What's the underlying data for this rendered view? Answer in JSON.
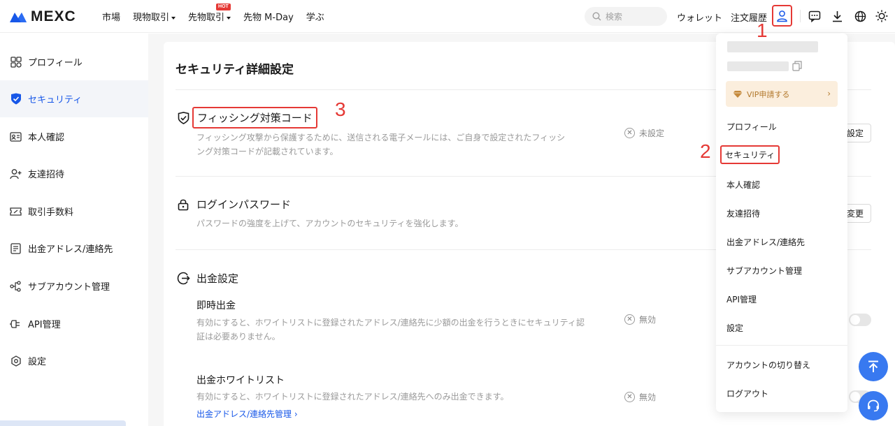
{
  "brand": {
    "name": "MEXC",
    "accent": "#1757e8",
    "annotation_color": "#e53935"
  },
  "nav": {
    "items": [
      {
        "label": "市場",
        "caret": false
      },
      {
        "label": "現物取引",
        "caret": true
      },
      {
        "label": "先物取引",
        "caret": true,
        "badge": "HOT"
      },
      {
        "label": "先物 M-Day",
        "caret": false
      },
      {
        "label": "学ぶ",
        "caret": false
      }
    ]
  },
  "header": {
    "search_placeholder": "検索",
    "wallet": "ウォレット",
    "orders": "注文履歴",
    "icons": [
      "user-icon",
      "chat-icon",
      "download-icon",
      "globe-icon",
      "theme-icon"
    ]
  },
  "sidebar": {
    "items": [
      {
        "label": "プロフィール",
        "icon": "profile-grid-icon",
        "active": false
      },
      {
        "label": "セキュリティ",
        "icon": "shield-check-icon",
        "active": true
      },
      {
        "label": "本人確認",
        "icon": "id-card-icon",
        "active": false
      },
      {
        "label": "友達招待",
        "icon": "add-user-icon",
        "active": false
      },
      {
        "label": "取引手数料",
        "icon": "fee-ticket-icon",
        "active": false
      },
      {
        "label": "出金アドレス/連絡先",
        "icon": "address-book-icon",
        "active": false
      },
      {
        "label": "サブアカウント管理",
        "icon": "sub-account-icon",
        "active": false
      },
      {
        "label": "API管理",
        "icon": "api-plug-icon",
        "active": false
      },
      {
        "label": "設定",
        "icon": "settings-hex-icon",
        "active": false
      }
    ]
  },
  "main": {
    "title": "セキュリティ詳細設定",
    "sections": {
      "phishing": {
        "title": "フィッシング対策コード",
        "desc_line1": "フィッシング攻撃から保護するために、送信される電子メールには、ご自身で設定されたフィッシ",
        "desc_line2": "ング対策コードが記載されています。",
        "status": "未設定",
        "action": "設定"
      },
      "login_password": {
        "title": "ログインパスワード",
        "desc": "パスワードの強度を上げて、アカウントのセキュリティを強化します。",
        "action": "変更"
      },
      "withdrawal": {
        "title": "出金設定",
        "instant": {
          "title": "即時出金",
          "desc_line1": "有効にすると、ホワイトリストに登録されたアドレス/連絡先に少額の出金を行うときにセキュリティ認",
          "desc_line2": "証は必要ありません。",
          "status": "無効"
        },
        "whitelist": {
          "title": "出金ホワイトリスト",
          "desc": "有効にすると、ホワイトリストに登録されたアドレス/連絡先へのみ出金できます。",
          "status": "無効",
          "link": "出金アドレス/連絡先管理 ›"
        }
      }
    }
  },
  "dropdown": {
    "vip": "VIP申請する",
    "items": [
      "プロフィール",
      "セキュリティ",
      "本人確認",
      "友達招待",
      "出金アドレス/連絡先",
      "サブアカウント管理",
      "API管理",
      "設定"
    ],
    "switch_account": "アカウントの切り替え",
    "logout": "ログアウト"
  },
  "annotations": {
    "step1": "1",
    "step2": "2",
    "step3": "3"
  }
}
